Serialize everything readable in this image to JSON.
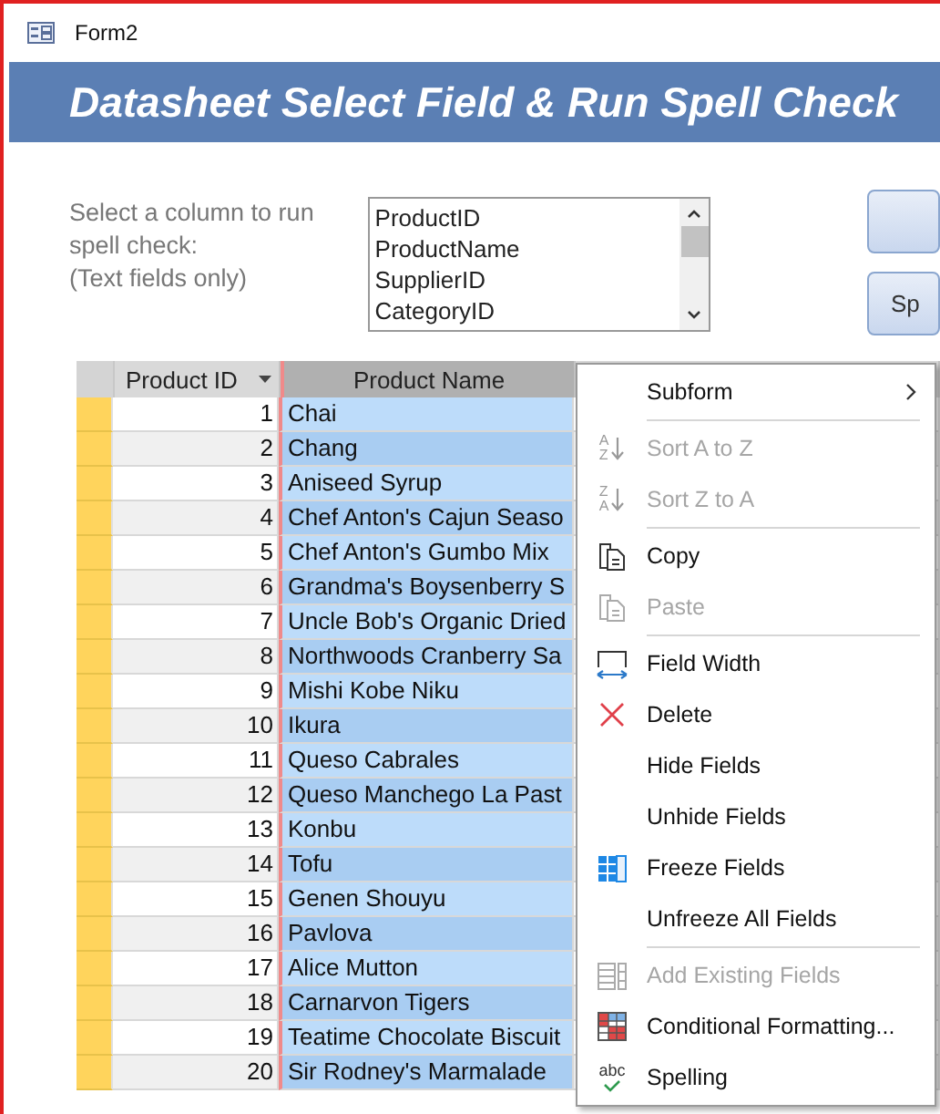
{
  "window": {
    "title": "Form2"
  },
  "header": {
    "title": "Datasheet Select Field & Run Spell Check"
  },
  "instructions": [
    "Select a column to run",
    "spell check:",
    "(Text fields only)"
  ],
  "field_list": {
    "items": [
      {
        "label": "ProductID",
        "selected": false
      },
      {
        "label": "ProductName",
        "selected": false
      },
      {
        "label": "SupplierID",
        "selected": false
      },
      {
        "label": "CategoryID",
        "selected": false
      }
    ]
  },
  "buttons": [
    {
      "kind": "blank"
    },
    {
      "kind": "labeled",
      "label": "Sp"
    }
  ],
  "datasheet": {
    "columns": [
      {
        "label": "Product ID",
        "selected": false,
        "kind": "number"
      },
      {
        "label": "Product Name",
        "selected": true,
        "kind": "text"
      }
    ],
    "rows": [
      {
        "id": "1",
        "name": "Chai"
      },
      {
        "id": "2",
        "name": "Chang"
      },
      {
        "id": "3",
        "name": "Aniseed Syrup"
      },
      {
        "id": "4",
        "name": "Chef Anton's Cajun Seaso"
      },
      {
        "id": "5",
        "name": "Chef Anton's Gumbo Mix"
      },
      {
        "id": "6",
        "name": "Grandma's Boysenberry S"
      },
      {
        "id": "7",
        "name": "Uncle Bob's Organic Dried"
      },
      {
        "id": "8",
        "name": "Northwoods Cranberry Sa"
      },
      {
        "id": "9",
        "name": "Mishi Kobe Niku"
      },
      {
        "id": "10",
        "name": "Ikura"
      },
      {
        "id": "11",
        "name": "Queso Cabrales"
      },
      {
        "id": "12",
        "name": "Queso Manchego La Past"
      },
      {
        "id": "13",
        "name": "Konbu"
      },
      {
        "id": "14",
        "name": "Tofu"
      },
      {
        "id": "15",
        "name": "Genen Shouyu"
      },
      {
        "id": "16",
        "name": "Pavlova"
      },
      {
        "id": "17",
        "name": "Alice Mutton"
      },
      {
        "id": "18",
        "name": "Carnarvon Tigers"
      },
      {
        "id": "19",
        "name": "Teatime Chocolate Biscuit"
      },
      {
        "id": "20",
        "name": "Sir Rodney's Marmalade"
      }
    ]
  },
  "context_menu": {
    "items": [
      {
        "kind": "submenu",
        "label": "Subform",
        "disabled": false
      },
      {
        "kind": "separator"
      },
      {
        "kind": "sort",
        "label": "Sort A to Z",
        "disabled": true,
        "glyph_top": "A",
        "glyph_bottom": "Z"
      },
      {
        "kind": "sort",
        "label": "Sort Z to A",
        "disabled": true,
        "glyph_top": "Z",
        "glyph_bottom": "A"
      },
      {
        "kind": "separator"
      },
      {
        "kind": "copy",
        "label": "Copy",
        "disabled": false
      },
      {
        "kind": "paste",
        "label": "Paste",
        "disabled": true
      },
      {
        "kind": "separator"
      },
      {
        "kind": "width",
        "label": "Field Width",
        "disabled": false
      },
      {
        "kind": "delete",
        "label": "Delete",
        "disabled": false
      },
      {
        "kind": "plain",
        "label": "Hide Fields",
        "disabled": false
      },
      {
        "kind": "plain",
        "label": "Unhide Fields",
        "disabled": false
      },
      {
        "kind": "freeze",
        "label": "Freeze Fields",
        "disabled": false
      },
      {
        "kind": "plain",
        "label": "Unfreeze All Fields",
        "disabled": false
      },
      {
        "kind": "separator"
      },
      {
        "kind": "addfields",
        "label": "Add Existing Fields",
        "disabled": true
      },
      {
        "kind": "condformat",
        "label": "Conditional Formatting...",
        "disabled": false
      },
      {
        "kind": "spelling",
        "label": "Spelling",
        "disabled": false,
        "glyph_top": "abc"
      }
    ]
  }
}
